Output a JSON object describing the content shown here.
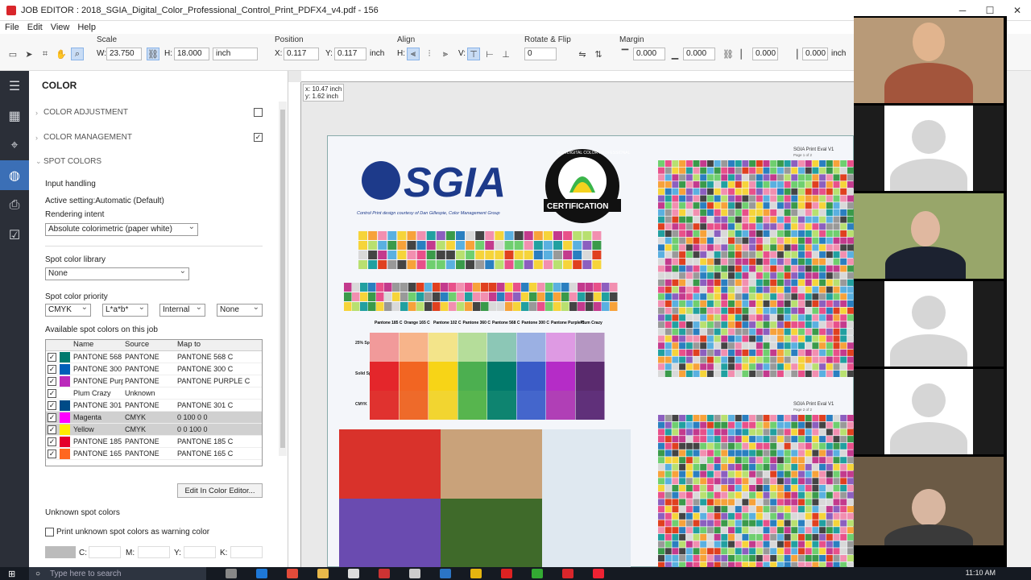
{
  "window": {
    "title": "JOB EDITOR : 2018_SGIA_Digital_Color_Professional_Control_Print_PDFX4_v4.pdf - 156"
  },
  "menu": [
    "File",
    "Edit",
    "View",
    "Help"
  ],
  "toolbar": {
    "scale_label": "Scale",
    "w_label": "W:",
    "w_value": "23.750",
    "h_label": "H:",
    "h_value": "18.000",
    "unit": "inch",
    "position_label": "Position",
    "x_label": "X:",
    "x_value": "0.117",
    "y_label": "Y:",
    "y_value": "0.117",
    "pos_unit": "inch",
    "align_label": "Align",
    "h_label2": "H:",
    "v_label": "V:",
    "rotate_label": "Rotate & Flip",
    "rotate_value": "0",
    "margin_label": "Margin",
    "margin_values": [
      "0.000",
      "0.000",
      "0.000",
      "0.000"
    ],
    "margin_unit": "inch"
  },
  "panel": {
    "title": "COLOR",
    "sections": [
      "COLOR ADJUSTMENT",
      "COLOR MANAGEMENT",
      "SPOT COLORS"
    ],
    "input_handling": "Input handling",
    "active_setting": "Active setting:Automatic (Default)",
    "rendering_intent_label": "Rendering intent",
    "rendering_intent_value": "Absolute colorimetric (paper white)",
    "spot_library_label": "Spot color library",
    "spot_library_value": "None",
    "priority_label": "Spot color priority",
    "priority": [
      "CMYK",
      "L*a*b*",
      "Internal",
      "None"
    ],
    "available_label": "Available spot colors on this job",
    "table_headers": [
      "Name",
      "Source",
      "Map to"
    ],
    "rows": [
      {
        "name": "PANTONE 568",
        "source": "PANTONE",
        "map": "PANTONE 568 C",
        "color": "#007a6e",
        "grey": false
      },
      {
        "name": "PANTONE 300",
        "source": "PANTONE",
        "map": "PANTONE 300 C",
        "color": "#005eb8",
        "grey": false
      },
      {
        "name": "PANTONE Purp",
        "source": "PANTONE",
        "map": "PANTONE PURPLE C",
        "color": "#bb29bb",
        "grey": false
      },
      {
        "name": "Plum Crazy",
        "source": "Unknown",
        "map": "",
        "color": "#ffffff",
        "grey": false
      },
      {
        "name": "PANTONE 301",
        "source": "PANTONE",
        "map": "PANTONE 301 C",
        "color": "#004b87",
        "grey": false
      },
      {
        "name": "Magenta",
        "source": "CMYK",
        "map": "0     100     0     0",
        "color": "#ff00ff",
        "grey": true
      },
      {
        "name": "Yellow",
        "source": "CMYK",
        "map": "0     0     100     0",
        "color": "#ffee00",
        "grey": true
      },
      {
        "name": "PANTONE 185",
        "source": "PANTONE",
        "map": "PANTONE 185 C",
        "color": "#e4002b",
        "grey": false
      },
      {
        "name": "PANTONE 165",
        "source": "PANTONE",
        "map": "PANTONE 165 C",
        "color": "#ff6720",
        "grey": false
      }
    ],
    "edit_button": "Edit In Color Editor...",
    "unknown_label": "Unknown spot colors",
    "print_unknown": "Print unknown spot colors as warning color",
    "cmyk_labels": [
      "C:",
      "M:",
      "Y:",
      "K:"
    ]
  },
  "canvas": {
    "coord_readout": "x: 10.47 inch\ny: 1.62 inch",
    "sgia_logo": "SGIA",
    "credit": "Control Print design courtesy of Dan Gillespie, Color Management Group",
    "cert_text": "CERTIFICATION",
    "cert_ring": "SGIA DIGITAL COLOR PROFESSIONAL",
    "eval_title_1": "SGIA Print Eval V1",
    "eval_page_1": "Page 1 of 2",
    "eval_title_2": "SGIA Print Eval V1",
    "eval_page_2": "Page 2 of 2",
    "spot_headers": [
      "Pantone 185 C",
      "Orange 165 C",
      "Pantone 102 C",
      "Pantone 360 C",
      "Pantone 568 C",
      "Pantone 300 C",
      "Pantone Purple C",
      "Plum Crazy"
    ],
    "row_labels": [
      "25% Spot Tint",
      "Solid Spot",
      "CMYK"
    ]
  },
  "taskbar": {
    "search_placeholder": "Type here to search",
    "time": "11:10 AM"
  }
}
